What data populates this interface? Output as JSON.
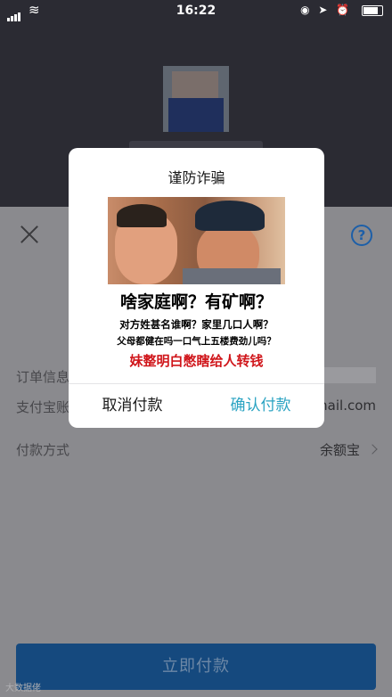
{
  "status_bar": {
    "time": "16:22",
    "right_icons": "◉ ➤ ⏰"
  },
  "modal": {
    "title": "谨防诈骗",
    "meme_line1": "啥家庭啊？有矿啊？",
    "meme_line2": "对方姓甚名谁啊？家里几口人啊？",
    "meme_line3": "父母都健在吗一口气上五楼费劲儿吗？",
    "meme_line4": "妹整明白憋瞎给人转钱",
    "cancel_label": "取消付款",
    "confirm_label": "确认付款"
  },
  "details": {
    "order_label": "订单信息",
    "account_label": "支付宝账",
    "account_value": "nail.com",
    "method_label": "付款方式",
    "method_value": "余额宝"
  },
  "pay_button_label": "立即付款",
  "watermark": "大数据佬",
  "colors": {
    "accent": "#2aa3c2",
    "warning_red": "#d0161b",
    "pay_button": "#15497e"
  }
}
